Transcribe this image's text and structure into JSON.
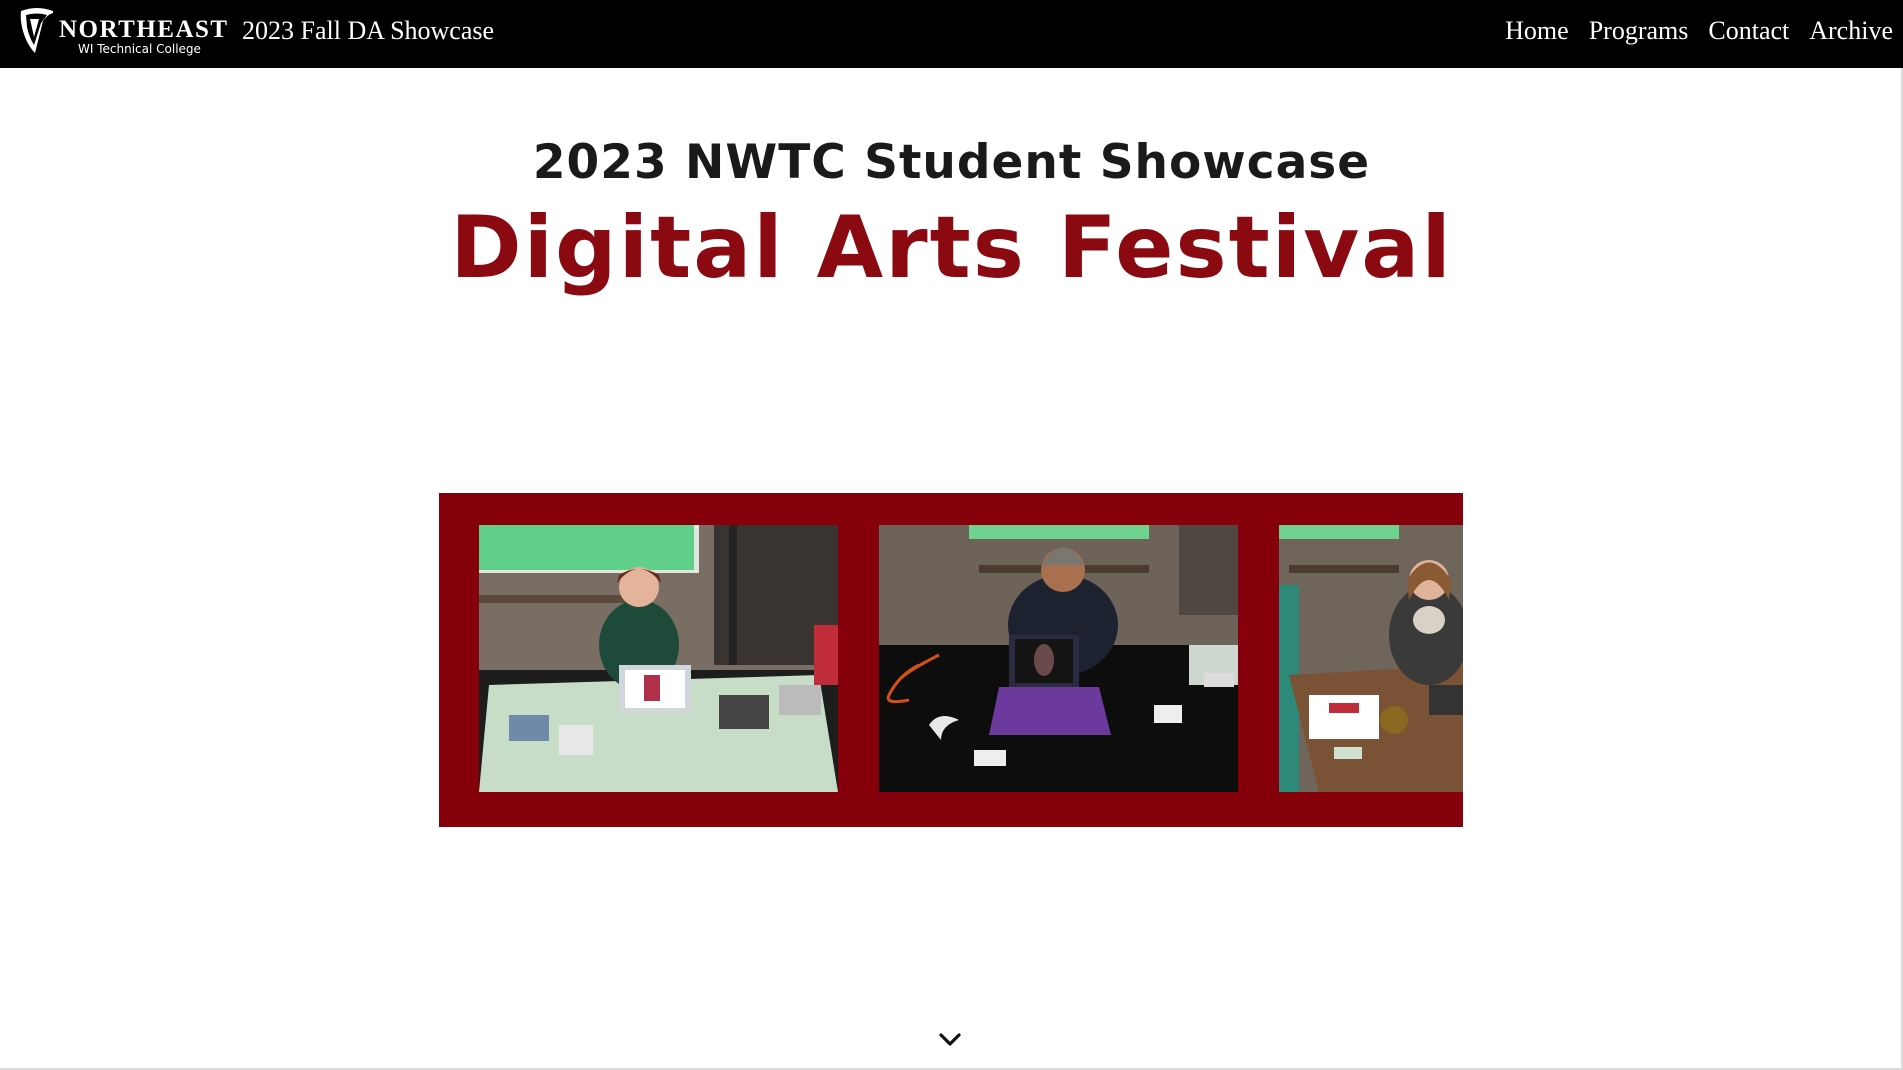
{
  "header": {
    "logo": {
      "name": "NORTHEAST",
      "subtitle": "WI Technical College"
    },
    "site_title": "2023 Fall DA Showcase",
    "nav": [
      {
        "label": "Home"
      },
      {
        "label": "Programs"
      },
      {
        "label": "Contact"
      },
      {
        "label": "Archive"
      }
    ]
  },
  "hero": {
    "heading": "2023 NWTC Student Showcase",
    "title": "Digital Arts Festival"
  },
  "carousel": {
    "background_color": "#85000b",
    "slides": [
      {
        "image_name": "student-presenter-photo-1"
      },
      {
        "image_name": "student-presenter-photo-2"
      },
      {
        "image_name": "student-presenter-photo-3"
      }
    ]
  },
  "colors": {
    "navbar": "#000000",
    "accent": "#8b0a12"
  },
  "icons": {
    "logo": "nwtc-shield-logo",
    "scroll": "chevron-down-icon"
  }
}
